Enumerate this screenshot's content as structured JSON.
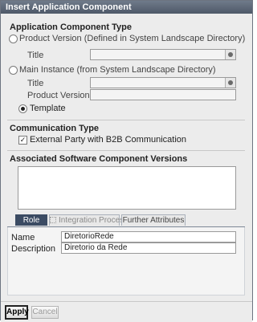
{
  "window": {
    "title": "Insert Application Component"
  },
  "app_type": {
    "section_title": "Application Component Type",
    "product_version": {
      "label": "Product Version (Defined in System Landscape Directory)",
      "title_label": "Title",
      "title_value": ""
    },
    "main_instance": {
      "label": "Main Instance (from System Landscape Directory)",
      "title_label": "Title",
      "title_value": "",
      "product_version_label": "Product Version",
      "product_version_value": ""
    },
    "template": {
      "label": "Template",
      "selected": true
    }
  },
  "communication": {
    "section_title": "Communication Type",
    "external_party": {
      "label": "External Party with B2B Communication",
      "checked": true
    }
  },
  "software_components": {
    "section_title": "Associated Software Component Versions"
  },
  "tabs": [
    {
      "label": "Role",
      "active": true
    },
    {
      "label": "Integration Process",
      "disabled": true
    },
    {
      "label": "Further Attributes"
    }
  ],
  "role": {
    "name_label": "Name",
    "name_value": "DiretorioRede",
    "description_label": "Description",
    "description_value": "Diretorio da Rede"
  },
  "buttons": {
    "apply": "Apply",
    "cancel": "Cancel"
  }
}
